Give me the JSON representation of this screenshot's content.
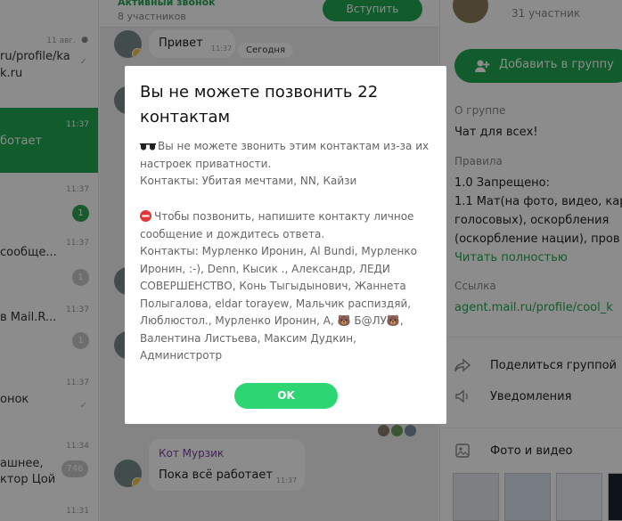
{
  "chat_list": {
    "items": [
      {
        "text": "ru/profile/ka",
        "text2": "k.ru",
        "time": "11 авг."
      },
      {
        "text": "ботает",
        "time": "11:37"
      },
      {
        "text": "",
        "time": "11:37",
        "badge": "1"
      },
      {
        "text": "сообще...",
        "time": "11:37",
        "badge": "1"
      },
      {
        "text": "в Mail.R...",
        "time": "11:37",
        "badge": "1"
      },
      {
        "text": "онок",
        "time": "11:37"
      },
      {
        "text": "ашнее,",
        "text2": "ктор Цой",
        "time": "11:34",
        "badge": "746"
      },
      {
        "text": "",
        "time": "11:31"
      }
    ]
  },
  "chat": {
    "call_title": "Активный звонок",
    "call_members": "8 участников",
    "join_label": "Вступить",
    "date_pill": "Сегодня",
    "messages": [
      {
        "text": "Привет",
        "time": "11:37"
      },
      {
        "author": "Кот Мурзик",
        "text": "Пока всё работает",
        "time": "11:37"
      }
    ]
  },
  "info": {
    "members": "31 участник",
    "add_label": "Добавить в группу",
    "about_label": "О группе",
    "about_text": "Чат для всех!",
    "rules_label": "Правила",
    "rules_lines": [
      "1.0 Запрещено:",
      "1.1 Мат(на фото, видео, кар",
      "голосовых), оскорбления",
      "(оскорбление нации), пров"
    ],
    "read_more": "Читать полностью",
    "link_label": "Ссылка",
    "link_value": "agent.mail.ru/profile/cool_k",
    "share_label": "Поделиться группой",
    "notify_label": "Уведомления",
    "media_label": "Фото и видео"
  },
  "modal": {
    "title": "Вы не можете позвонить 22 контактам",
    "privacy_text": "Вы не можете звонить этим контактам из-за их настроек приватности.",
    "privacy_contacts": "Контакты: Убитая мечтами, NN, Кайзи",
    "message_text": "Чтобы позвонить, напишите контакту личное сообщение и дождитесь ответа.",
    "message_contacts": "Контакты: Мурленко Иронин, Al Bundi, Мурленко Иронин, :-), Denn, Кысик ., Александр, ЛЕДИ СОВЕРШЕНСТВО, Конь Тыгыдынович, Жаннета Полыгалова, eldar torayew, Мальчик распиздяй, Люблюстол., Мурленко Иронин, А, 🐻 Б@ЛУ🐻, Валентина Листьева, Максим Дудкин, Администротр",
    "ok_label": "OK"
  },
  "colors": {
    "accent": "#22a650",
    "ok_button": "#2ed573",
    "overlay": "rgba(0,0,0,0.45)"
  }
}
